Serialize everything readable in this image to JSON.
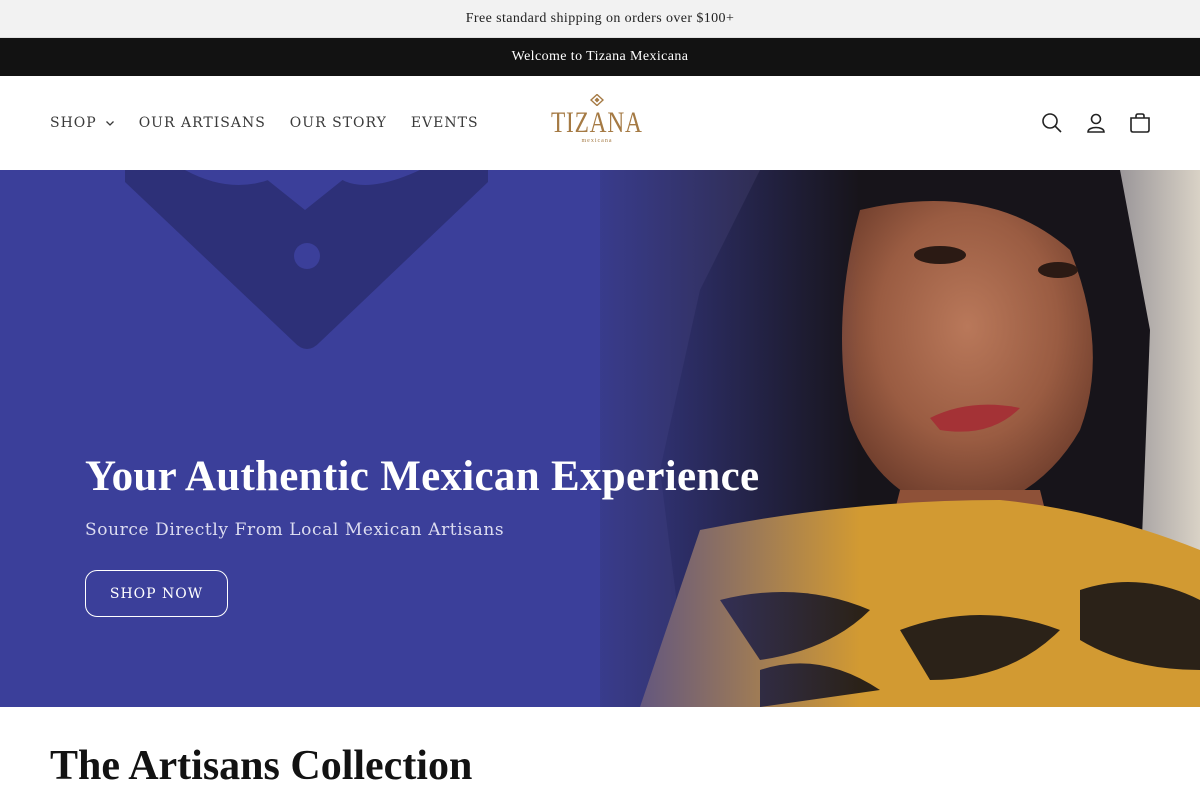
{
  "announcements": {
    "shipping": "Free standard shipping on orders over $100+",
    "welcome": "Welcome to Tizana Mexicana"
  },
  "nav": {
    "items": [
      {
        "label": "SHOP",
        "has_dropdown": true
      },
      {
        "label": "OUR ARTISANS"
      },
      {
        "label": "OUR STORY"
      },
      {
        "label": "EVENTS"
      }
    ]
  },
  "logo": {
    "word": "TIZANA",
    "tagline": "mexicana"
  },
  "header_icons": [
    "search-icon",
    "account-icon",
    "cart-icon"
  ],
  "hero": {
    "title": "Your Authentic Mexican Experience",
    "subtitle": "Source Directly From Local Mexican Artisans",
    "cta_label": "SHOP NOW"
  },
  "collection": {
    "title": "The Artisans Collection"
  },
  "colors": {
    "hero_blue": "#3b3f9a",
    "logo_gold": "#a57a44",
    "dark_bar": "#121212"
  }
}
